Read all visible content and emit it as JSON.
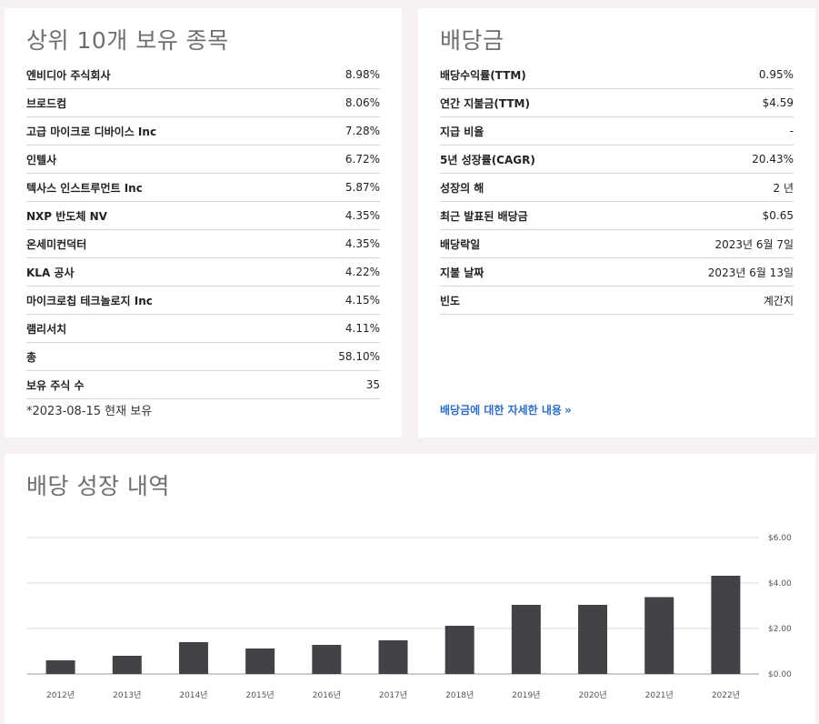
{
  "holdings": {
    "title": "상위 10개 보유 종목",
    "rows": [
      {
        "label": "엔비디아 주식회사",
        "value": "8.98%"
      },
      {
        "label": "브로드컴",
        "value": "8.06%"
      },
      {
        "label": "고급 마이크로 디바이스 Inc",
        "value": "7.28%"
      },
      {
        "label": "인텔사",
        "value": "6.72%"
      },
      {
        "label": "텍사스 인스트루먼트 Inc",
        "value": "5.87%"
      },
      {
        "label": "NXP 반도체 NV",
        "value": "4.35%"
      },
      {
        "label": "온세미컨덕터",
        "value": "4.35%"
      },
      {
        "label": "KLA 공사",
        "value": "4.22%"
      },
      {
        "label": "마이크로칩 테크놀로지 Inc",
        "value": "4.15%"
      },
      {
        "label": "램리서치",
        "value": "4.11%"
      },
      {
        "label": "총",
        "value": "58.10%"
      },
      {
        "label": "보유 주식 수",
        "value": "35"
      }
    ],
    "footnote": "*2023-08-15 현재 보유"
  },
  "dividend": {
    "title": "배당금",
    "rows": [
      {
        "label": "배당수익률(TTM)",
        "value": "0.95%"
      },
      {
        "label": "연간 지불금(TTM)",
        "value": "$4.59"
      },
      {
        "label": "지급 비율",
        "value": "-"
      },
      {
        "label": "5년 성장률(CAGR)",
        "value": "20.43%"
      },
      {
        "label": "성장의 해",
        "value": "2 년"
      },
      {
        "label": "최근 발표된 배당금",
        "value": "$0.65"
      },
      {
        "label": "배당락일",
        "value": "2023년 6월 7일"
      },
      {
        "label": "지불 날짜",
        "value": "2023년 6월 13일"
      },
      {
        "label": "빈도",
        "value": "계간지"
      }
    ],
    "more_link": "배당금에 대한 자세한 내용",
    "more_arrow": "»"
  },
  "history": {
    "title": "배당 성장 내역"
  },
  "chart_data": {
    "type": "bar",
    "title": "배당 성장 내역",
    "categories": [
      "2012년",
      "2013년",
      "2014년",
      "2015년",
      "2016년",
      "2017년",
      "2018년",
      "2019년",
      "2020년",
      "2021년",
      "2022년"
    ],
    "values": [
      0.6,
      0.8,
      1.4,
      1.12,
      1.28,
      1.48,
      2.12,
      3.04,
      3.04,
      3.38,
      4.32
    ],
    "ylim": [
      0,
      6
    ],
    "yticks": [
      0,
      2,
      4,
      6
    ],
    "ytick_labels": [
      "$0.00",
      "$2.00",
      "$4.00",
      "$6.00"
    ],
    "ylabel": "",
    "xlabel": "",
    "grid": true,
    "bar_color": "#434246",
    "grid_color": "#d9d9d9"
  }
}
